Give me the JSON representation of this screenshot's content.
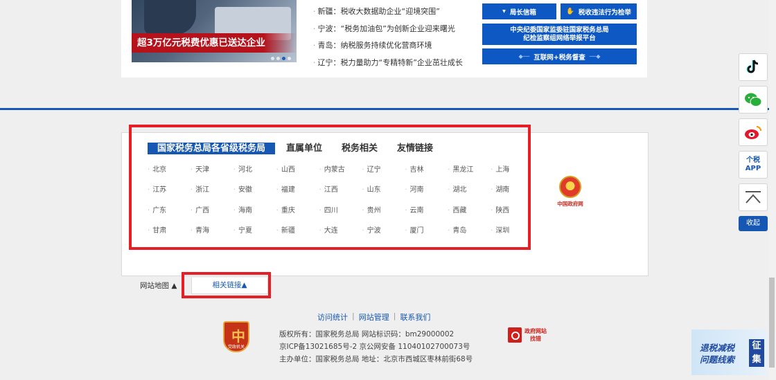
{
  "banner": {
    "caption": "超3万亿元税费优惠已送达企业"
  },
  "news": [
    "新疆：税收大数据助企业“迎境突围”",
    "宁波：“税务加油包”为创新企业迎来曙光",
    "青岛：纳税服务持续优化营商环境",
    "辽宁：税力量助力“专精特新”企业茁壮成长"
  ],
  "quick_links": {
    "mailbox": "局长信箱",
    "report": "税收违法行为检举",
    "discipline_line1": "中央纪委国家监委驻国家税务总局",
    "discipline_line2": "纪检监察组网络举报平台",
    "supervision": "互联网+税务督查"
  },
  "links_panel": {
    "tabs": [
      "国家税务总局各省级税务局",
      "直属单位",
      "税务相关",
      "友情链接"
    ],
    "provinces": [
      "北京",
      "天津",
      "河北",
      "山西",
      "内蒙古",
      "辽宁",
      "吉林",
      "黑龙江",
      "上海",
      "江苏",
      "浙江",
      "安徽",
      "福建",
      "江西",
      "山东",
      "河南",
      "湖北",
      "湖南",
      "广东",
      "广西",
      "海南",
      "重庆",
      "四川",
      "贵州",
      "云南",
      "西藏",
      "陕西",
      "甘肃",
      "青海",
      "宁夏",
      "新疆",
      "大连",
      "宁波",
      "厦门",
      "青岛",
      "深圳"
    ],
    "gov_emblem_text": "中国政府网"
  },
  "bottom_tabs": {
    "sitemap": "网站地图 ▲",
    "related": "相关链接▲"
  },
  "footer": {
    "links": [
      "访问统计",
      "网站管理",
      "联系我们"
    ],
    "copyright": "版权所有：国家税务总局   网站标识码：bm29000002",
    "icp": "京ICP备13021685号-2     京公网安备 11040102700073号",
    "sponsor": "主办单位：国家税务总局   地址：北京市西城区枣林前街68号",
    "badge_text": "党政机关",
    "gov_site_line1": "政府网站",
    "gov_site_line2": "找错"
  },
  "side_buttons": {
    "app_line1": "个税",
    "app_line2": "APP",
    "collapse": "收起"
  },
  "promo": {
    "line1": "退税减税",
    "line2": "问题线索",
    "badge": "征集"
  }
}
